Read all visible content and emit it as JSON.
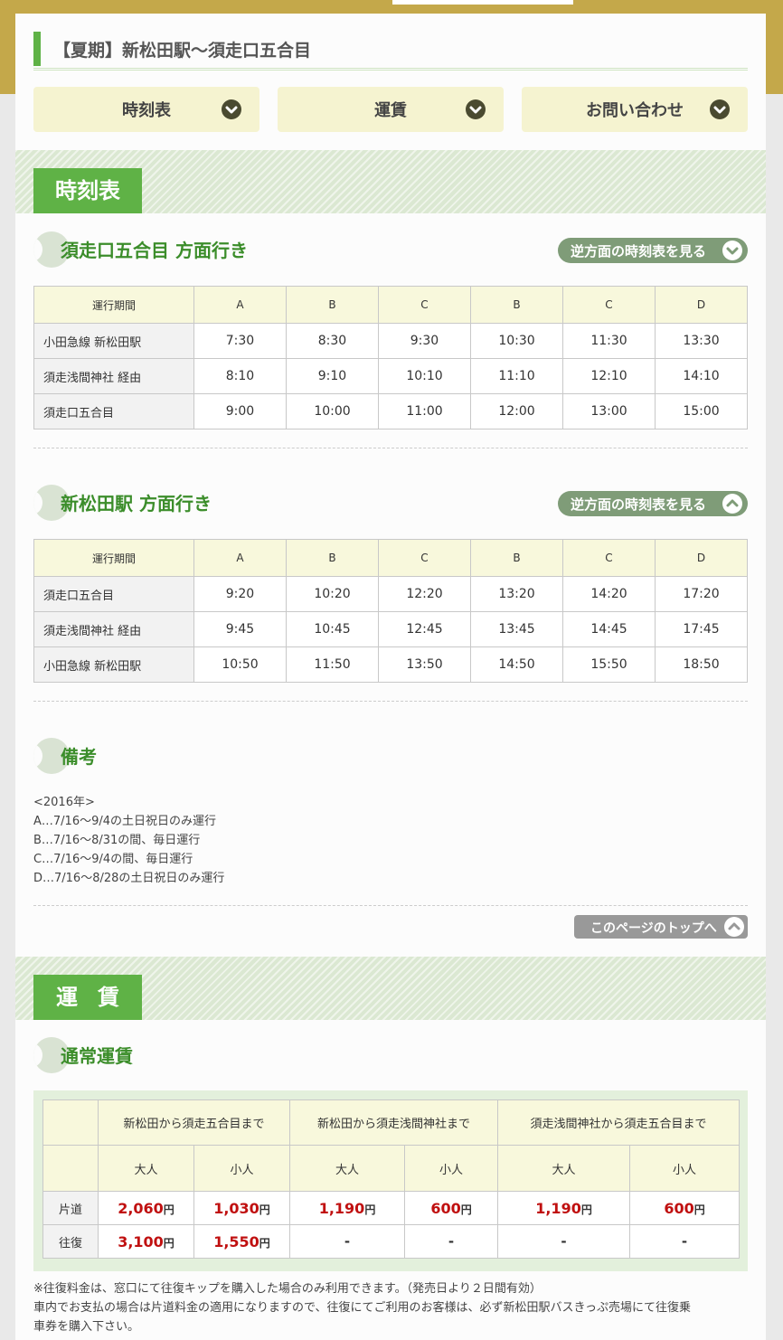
{
  "header": {
    "title": "【夏期】新松田駅～須走口五合目",
    "nav": [
      "時刻表",
      "運賃",
      "お問い合わせ"
    ]
  },
  "timetable": {
    "band_title": "時刻表",
    "reverse_label": "逆方面の時刻表を見る",
    "sections": [
      {
        "heading": "須走口五合目 方面行き",
        "period_label": "運行期間",
        "columns": [
          "A",
          "B",
          "C",
          "B",
          "C",
          "D"
        ],
        "rows": [
          {
            "stop": "小田急線 新松田駅",
            "times": [
              "7:30",
              "8:30",
              "9:30",
              "10:30",
              "11:30",
              "13:30"
            ]
          },
          {
            "stop": "須走浅間神社 経由",
            "times": [
              "8:10",
              "9:10",
              "10:10",
              "11:10",
              "12:10",
              "14:10"
            ]
          },
          {
            "stop": "須走口五合目",
            "times": [
              "9:00",
              "10:00",
              "11:00",
              "12:00",
              "13:00",
              "15:00"
            ]
          }
        ]
      },
      {
        "heading": "新松田駅 方面行き",
        "period_label": "運行期間",
        "columns": [
          "A",
          "B",
          "C",
          "B",
          "C",
          "D"
        ],
        "rows": [
          {
            "stop": "須走口五合目",
            "times": [
              "9:20",
              "10:20",
              "12:20",
              "13:20",
              "14:20",
              "17:20"
            ]
          },
          {
            "stop": "須走浅間神社 経由",
            "times": [
              "9:45",
              "10:45",
              "12:45",
              "13:45",
              "14:45",
              "17:45"
            ]
          },
          {
            "stop": "小田急線 新松田駅",
            "times": [
              "10:50",
              "11:50",
              "13:50",
              "14:50",
              "15:50",
              "18:50"
            ]
          }
        ]
      }
    ],
    "notes_heading": "備考",
    "notes": [
      "<2016年>",
      "A…7/16～9/4の土日祝日のみ運行",
      "B…7/16～8/31の間、毎日運行",
      "C…7/16～9/4の間、毎日運行",
      "D…7/16～8/28の土日祝日のみ運行"
    ],
    "page_top_label": "このページのトップへ"
  },
  "fare": {
    "band_title": "運賃",
    "heading": "通常運賃",
    "routes": [
      "新松田から須走五合目まで",
      "新松田から須走浅間神社まで",
      "須走浅間神社から須走五合目まで"
    ],
    "adult": "大人",
    "child": "小人",
    "yen": "円",
    "dash": "-",
    "rows": [
      {
        "label": "片道",
        "values": [
          "2,060",
          "1,030",
          "1,190",
          "600",
          "1,190",
          "600"
        ]
      },
      {
        "label": "往復",
        "values": [
          "3,100",
          "1,550",
          "-",
          "-",
          "-",
          "-"
        ]
      }
    ],
    "notes": [
      "※往復料金は、窓口にて往復キップを購入した場合のみ利用できます。（発売日より２日間有効）",
      "車内でお支払の場合は片道料金の適用になりますので、往復にてご利用のお客様は、必ず新松田駅バスきっぷ売場にて往復乗",
      "車券を購入下さい。"
    ]
  },
  "colors": {
    "gold": "#c4a84a",
    "green": "#5fb246",
    "heading_green": "#3b8d2a",
    "fare_red": "#c01010",
    "nav_bg": "#f5f3d0"
  }
}
